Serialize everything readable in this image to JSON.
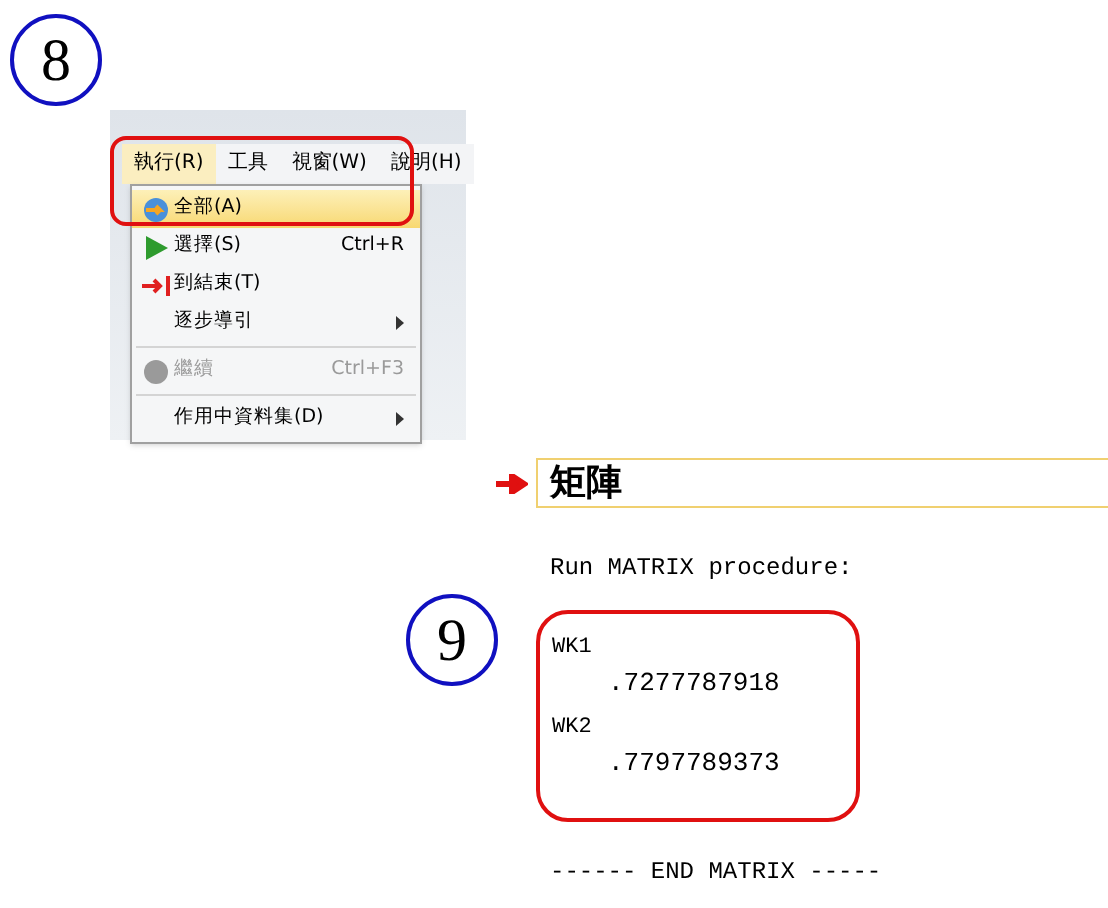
{
  "step_markers": [
    "8",
    "9"
  ],
  "menu_bar": [
    {
      "label": "執行(R)",
      "selected": true
    },
    {
      "label": "工具",
      "selected": false
    },
    {
      "label": "視窗(W)",
      "selected": false
    },
    {
      "label": "說明(H)",
      "selected": false
    }
  ],
  "menu": [
    {
      "kind": "item",
      "label": "全部(A)",
      "submenu": false,
      "selected": true,
      "disabled": false
    },
    {
      "kind": "item",
      "label": "選擇(S)",
      "shortcut": "Ctrl+R",
      "submenu": false,
      "selected": false,
      "disabled": false
    },
    {
      "kind": "item",
      "label": "到結束(T)",
      "submenu": false,
      "selected": false,
      "disabled": false
    },
    {
      "kind": "item",
      "label": "逐步導引",
      "submenu": true,
      "selected": false,
      "disabled": false
    },
    {
      "kind": "separator"
    },
    {
      "kind": "item",
      "label": "繼續",
      "shortcut": "Ctrl+F3",
      "submenu": false,
      "selected": false,
      "disabled": true
    },
    {
      "kind": "separator"
    },
    {
      "kind": "item",
      "label": "作用中資料集(D)",
      "submenu": true,
      "selected": false,
      "disabled": false
    }
  ],
  "output": {
    "heading": "矩陣",
    "intro": "Run MATRIX procedure:",
    "results": [
      {
        "name": "WK1",
        "value": ".7277787918"
      },
      {
        "name": "WK2",
        "value": ".7797789373"
      }
    ],
    "footer": "------ END MATRIX -----"
  }
}
